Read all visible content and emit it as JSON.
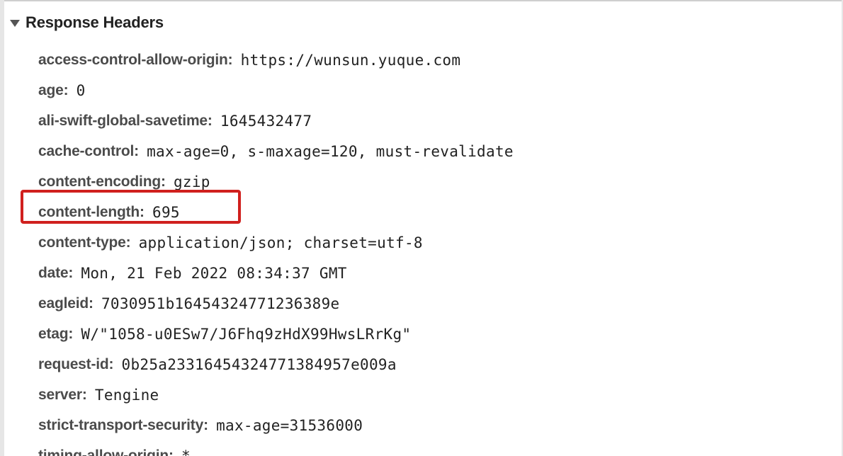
{
  "section": {
    "title": "Response Headers",
    "expanded": true
  },
  "headers": [
    {
      "name": "access-control-allow-origin",
      "value": "https://wunsun.yuque.com"
    },
    {
      "name": "age",
      "value": "0"
    },
    {
      "name": "ali-swift-global-savetime",
      "value": "1645432477"
    },
    {
      "name": "cache-control",
      "value": "max-age=0, s-maxage=120, must-revalidate"
    },
    {
      "name": "content-encoding",
      "value": "gzip"
    },
    {
      "name": "content-length",
      "value": "695"
    },
    {
      "name": "content-type",
      "value": "application/json; charset=utf-8"
    },
    {
      "name": "date",
      "value": "Mon, 21 Feb 2022 08:34:37 GMT"
    },
    {
      "name": "eagleid",
      "value": "7030951b16454324771236389e"
    },
    {
      "name": "etag",
      "value": "W/\"1058-u0ESw7/J6Fhq9zHdX99HwsLRrKg\""
    },
    {
      "name": "request-id",
      "value": "0b25a23316454324771384957e009a"
    },
    {
      "name": "server",
      "value": "Tengine"
    },
    {
      "name": "strict-transport-security",
      "value": "max-age=31536000"
    },
    {
      "name": "timing-allow-origin",
      "value": "*"
    }
  ],
  "highlight": {
    "target_header": "content-length",
    "color": "#d0201e"
  },
  "colors": {
    "header_name": "#4b4b4b",
    "header_value": "#222222",
    "title": "#222222"
  }
}
